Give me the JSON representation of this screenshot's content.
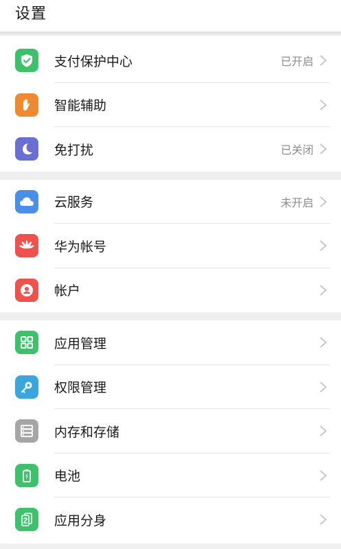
{
  "header": {
    "title": "设置"
  },
  "groups": [
    {
      "items": [
        {
          "label": "支付保护中心",
          "value": "已开启",
          "icon": "shield-check-icon",
          "color": "#3dc26b"
        },
        {
          "label": "智能辅助",
          "value": "",
          "icon": "hand-icon",
          "color": "#f08a30"
        },
        {
          "label": "免打扰",
          "value": "已关闭",
          "icon": "moon-icon",
          "color": "#6a6fd4"
        }
      ]
    },
    {
      "items": [
        {
          "label": "云服务",
          "value": "未开启",
          "icon": "cloud-icon",
          "color": "#4a8fe6"
        },
        {
          "label": "华为帐号",
          "value": "",
          "icon": "huawei-logo-icon",
          "color": "#f0514c"
        },
        {
          "label": "帐户",
          "value": "",
          "icon": "user-icon",
          "color": "#f0514c"
        }
      ]
    },
    {
      "items": [
        {
          "label": "应用管理",
          "value": "",
          "icon": "app-grid-icon",
          "color": "#3dc26b"
        },
        {
          "label": "权限管理",
          "value": "",
          "icon": "key-icon",
          "color": "#3aa6dd"
        },
        {
          "label": "内存和存储",
          "value": "",
          "icon": "storage-icon",
          "color": "#a6a6a6"
        },
        {
          "label": "电池",
          "value": "",
          "icon": "battery-icon",
          "color": "#3dc26b"
        },
        {
          "label": "应用分身",
          "value": "",
          "icon": "app-twin-icon",
          "color": "#3dc26b"
        }
      ]
    }
  ]
}
